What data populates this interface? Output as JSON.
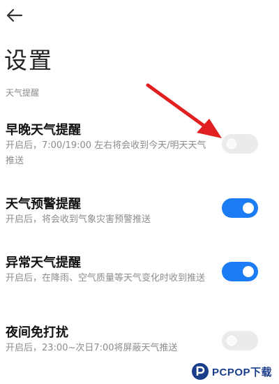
{
  "header": {
    "back_icon": "arrow-left-icon",
    "title": "设置"
  },
  "section": {
    "label": "天气提醒"
  },
  "settings": [
    {
      "title": "早晚天气提醒",
      "description": "开启后，7:00/19:00 左右将会收到今天/明天天气推送",
      "enabled": false
    },
    {
      "title": "天气预警提醒",
      "description": "开启后，将会收到气象灾害预警推送",
      "enabled": true
    },
    {
      "title": "异常天气提醒",
      "description": "开启后，在降雨、空气质量等天气变化时收到推送",
      "enabled": true
    },
    {
      "title": "夜间免打扰",
      "description": "开启后，23:00~次日7:00将屏蔽天气推送",
      "enabled": false
    }
  ],
  "colors": {
    "toggle_on": "#1c7cf3",
    "toggle_off": "#ebebeb",
    "arrow_annotation": "#e02020"
  },
  "watermark": {
    "text": "PCPOP下载"
  }
}
